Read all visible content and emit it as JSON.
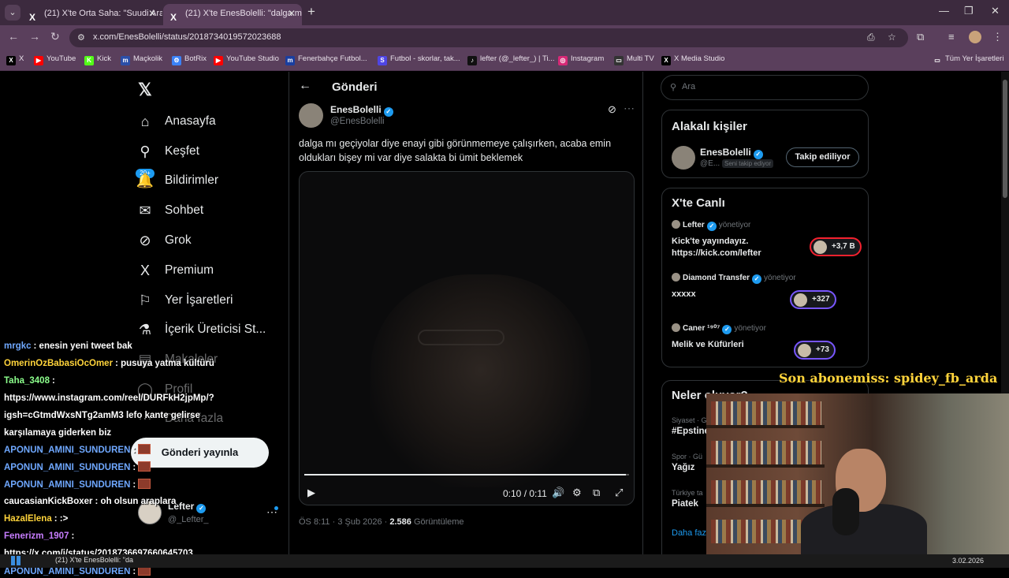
{
  "browser": {
    "tabs": [
      {
        "label": "(21) X'te Orta Saha: \"Suudi Arab",
        "favicon": "X"
      },
      {
        "label": "(21) X'te EnesBolelli: \"dalga mı g",
        "favicon": "X"
      }
    ],
    "url": "x.com/EnesBolelli/status/2018734019572023688",
    "bookmarks": [
      {
        "label": "X",
        "color": "#000000",
        "icon": "X"
      },
      {
        "label": "YouTube",
        "color": "#ff0000",
        "icon": "▶"
      },
      {
        "label": "Kick",
        "color": "#53fc18",
        "icon": "K"
      },
      {
        "label": "Maçkolik",
        "color": "#2b4fa8",
        "icon": "m"
      },
      {
        "label": "BotRix",
        "color": "#3b82f6",
        "icon": "⚙"
      },
      {
        "label": "YouTube Studio",
        "color": "#ff0000",
        "icon": "▶"
      },
      {
        "label": "Fenerbahçe Futbol...",
        "color": "#1a3fa0",
        "icon": "m"
      },
      {
        "label": "Futbol - skorlar, tak...",
        "color": "#4f46e5",
        "icon": "S"
      },
      {
        "label": "lefter (@_lefter_) | Ti...",
        "color": "#111111",
        "icon": "♪"
      },
      {
        "label": "Instagram",
        "color": "#d62976",
        "icon": "◎"
      },
      {
        "label": "Multi TV",
        "color": "#333333",
        "icon": "▭"
      },
      {
        "label": "X Media Studio",
        "color": "#000000",
        "icon": "X"
      }
    ],
    "all_bookmarks": "Tüm Yer İşaretleri"
  },
  "nav": {
    "items": [
      {
        "label": "Anasayfa",
        "icon": "⌂"
      },
      {
        "label": "Keşfet",
        "icon": "⚲"
      },
      {
        "label": "Bildirimler",
        "icon": "🔔"
      },
      {
        "label": "Sohbet",
        "icon": "✉"
      },
      {
        "label": "Grok",
        "icon": "⊘"
      },
      {
        "label": "Premium",
        "icon": "X"
      },
      {
        "label": "Yer İşaretleri",
        "icon": "⚐"
      },
      {
        "label": "İçerik Üreticisi St...",
        "icon": "⚗"
      },
      {
        "label": "Makaleler",
        "icon": "▤"
      },
      {
        "label": "Profil",
        "icon": "◯"
      },
      {
        "label": "Daha fazla",
        "icon": "⋯"
      }
    ],
    "notif_badge": "20+",
    "post_button": "Gönderi yayınla",
    "account": {
      "name": "Lefter",
      "handle": "@_Lefter_"
    }
  },
  "post": {
    "header": "Gönderi",
    "author_name": "EnesBolelli",
    "author_handle": "@EnesBolelli",
    "text": "dalga mı geçiyolar diye enayi gibi görünmemeye çalışırken, acaba emin oldukları bişey mi var diye salakta bi ümit beklemek",
    "video_time": "0:10 / 0:11",
    "video_progress": 0.99,
    "timestamp": "ÖS 8:11 · 3 Şub 2026 · ",
    "views": "2.586",
    "views_label": " Görüntüleme"
  },
  "sidebar": {
    "search_placeholder": "Ara",
    "related_title": "Alakalı kişiler",
    "related": {
      "name": "EnesBolelli",
      "handle": "@E...",
      "tag": "Seni takip ediyor",
      "button": "Takip ediliyor"
    },
    "live_title": "X'te Canlı",
    "live": [
      {
        "host": "Lefter",
        "role": "yönetiyor",
        "title": "Kick'te yayındayız. https://kick.com/lefter",
        "count": "+3,7 B"
      },
      {
        "host": "Diamond Transfer",
        "role": "yönetiyor",
        "title": "xxxxx",
        "count": "+327"
      },
      {
        "host": "Caner ¹⁹⁰⁷",
        "role": "yönetiyor",
        "title": "Melik ve Küfürleri",
        "count": "+73"
      }
    ],
    "trends_title": "Neler oluyor?",
    "trends": [
      {
        "category": "Siyaset · G",
        "name": "#Epstine"
      },
      {
        "category": "Spor · Gü",
        "name": "Yağız"
      },
      {
        "category": "Türkiye ta",
        "name": "Piatek"
      }
    ],
    "more_link": "Daha faz"
  },
  "stream": {
    "sub_banner": "Son abonemiss: spidey_fb_arda",
    "chat": [
      {
        "user": "mrgkc",
        "color": "#6fa8ff",
        "text": ": enesin yeni tweet bak",
        "emote": false
      },
      {
        "user": "OmerinOzBabasiOcOmer",
        "color": "#ffd43b",
        "text": ": pusuya yatma kültürü",
        "emote": false
      },
      {
        "user": "Taha_3408",
        "color": "#8cff8c",
        "text": ":",
        "emote": false
      },
      {
        "user": "",
        "color": "#ffffff",
        "text": "https://www.instagram.com/reel/DURFkH2jpMp/?",
        "emote": false
      },
      {
        "user": "",
        "color": "#ffffff",
        "text": "igsh=cGtmdWxsNTg2amM3 lefo kante gelirse",
        "emote": false
      },
      {
        "user": "",
        "color": "#ffffff",
        "text": "karşılamaya giderken biz",
        "emote": false
      },
      {
        "user": "APONUN_AMINI_SUNDUREN",
        "color": "#6fa8ff",
        "text": ":",
        "emote": true
      },
      {
        "user": "APONUN_AMINI_SUNDUREN",
        "color": "#6fa8ff",
        "text": ":",
        "emote": true
      },
      {
        "user": "APONUN_AMINI_SUNDUREN",
        "color": "#6fa8ff",
        "text": ":",
        "emote": true
      },
      {
        "user": "caucasianKickBoxer",
        "color": "#ffffff",
        "text": ": oh olsun araplara",
        "emote": false
      },
      {
        "user": "HazalElena",
        "color": "#ffd43b",
        "text": ": :>",
        "emote": false
      },
      {
        "user": "Fenerizm_1907",
        "color": "#c77dff",
        "text": ":",
        "emote": false
      },
      {
        "user": "",
        "color": "#ffffff",
        "text": "https://x.com/i/status/2018736697660645703",
        "emote": false
      },
      {
        "user": "APONUN_AMINI_SUNDUREN",
        "color": "#6fa8ff",
        "text": ":",
        "emote": true
      }
    ]
  },
  "taskbar": {
    "app": "(21) X'te EnesBolelli: \"da",
    "date": "3.02.2026"
  }
}
